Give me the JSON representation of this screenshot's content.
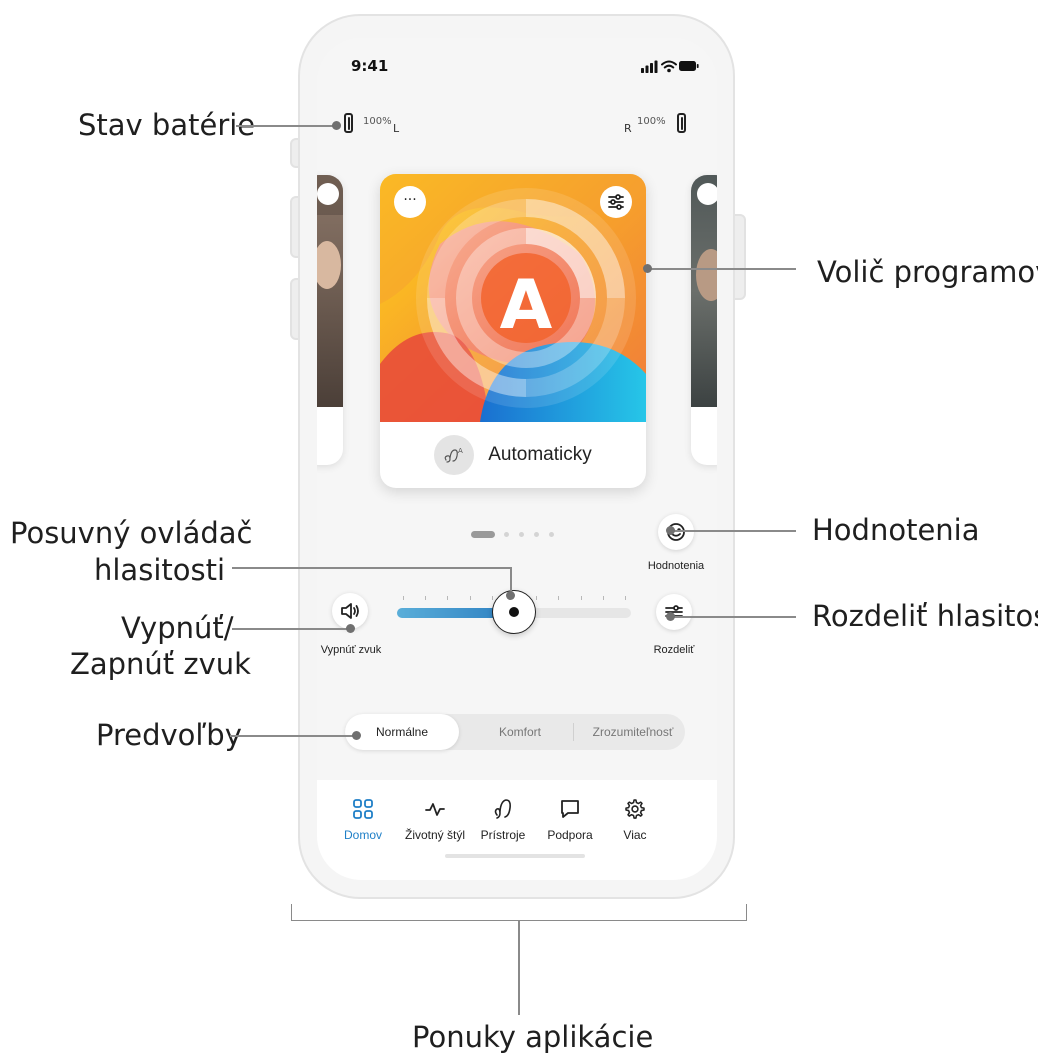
{
  "status_bar": {
    "time": "9:41"
  },
  "battery": {
    "left_percent": "100%",
    "left_side": "L",
    "right_percent": "100%",
    "right_side": "R"
  },
  "program": {
    "name": "Automaticky",
    "letter": "A",
    "more_icon": "ellipsis-icon",
    "settings_icon": "sliders-icon"
  },
  "pager": {
    "count": 5,
    "active": 0
  },
  "rating": {
    "label": "Hodnotenia",
    "icon": "smiley-icon"
  },
  "mute": {
    "label": "Vypnúť zvuk",
    "icon": "speaker-icon"
  },
  "split": {
    "label": "Rozdeliť",
    "icon": "split-volume-icon"
  },
  "volume": {
    "level": 0.5
  },
  "presets": {
    "items": [
      "Normálne",
      "Komfort",
      "Zrozumiteľnosť"
    ],
    "active": 0
  },
  "tabs": [
    {
      "label": "Domov",
      "icon": "grid-icon",
      "active": true
    },
    {
      "label": "Životný štýl",
      "icon": "activity-icon",
      "active": false
    },
    {
      "label": "Prístroje",
      "icon": "hearing-aid-icon",
      "active": false
    },
    {
      "label": "Podpora",
      "icon": "chat-icon",
      "active": false
    },
    {
      "label": "Viac",
      "icon": "gear-icon",
      "active": false
    }
  ],
  "callouts": {
    "battery_status": "Stav batérie",
    "program_selector": "Volič programov",
    "volume_slider_line1": "Posuvný ovládač",
    "volume_slider_line2": "hlasitosti",
    "ratings": "Hodnotenia",
    "mute_line1": "Vypnúť/",
    "mute_line2": "Zapnúť zvuk",
    "split_volume": "Rozdeliť hlasitosť",
    "presets": "Predvoľby",
    "app_menus": "Ponuky aplikácie"
  },
  "colors": {
    "accent": "#1f7fc7",
    "slider_fill": "#2d7fc1"
  }
}
